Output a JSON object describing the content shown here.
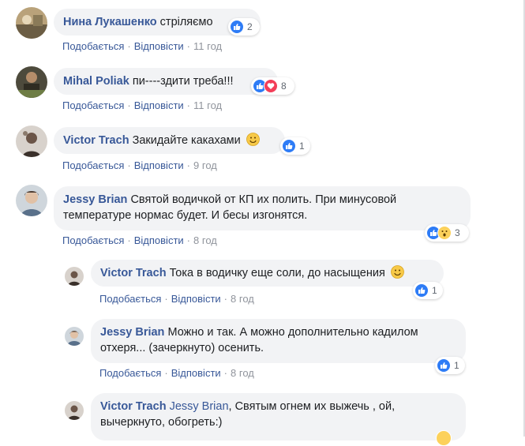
{
  "actions": {
    "like": "Подобається",
    "reply": "Відповісти"
  },
  "comments": [
    {
      "author": "Нина Лукашенко",
      "text": "стріляємо",
      "time": "11 год",
      "reaction_count": "2",
      "reactions": [
        "like"
      ]
    },
    {
      "author": "Mihal Poliak",
      "text": "пи----здити треба!!!",
      "time": "11 год",
      "reaction_count": "8",
      "reactions": [
        "like",
        "love"
      ]
    },
    {
      "author": "Victor Trach",
      "text": "Закидайте какахами",
      "time": "9 год",
      "reaction_count": "1",
      "reactions": [
        "like"
      ],
      "emoji": "smile"
    },
    {
      "author": "Jessy Brian",
      "text": "Святой водичкой от КП их полить. При минусовой температуре нормас будет. И бесы изгонятся.",
      "time": "8 год",
      "reaction_count": "3",
      "reactions": [
        "like",
        "wow"
      ]
    }
  ],
  "replies": [
    {
      "author": "Victor Trach",
      "text": "Тока в водичку еще соли, до насыщения",
      "time": "8 год",
      "reaction_count": "1",
      "reactions": [
        "like"
      ],
      "emoji": "smile"
    },
    {
      "author": "Jessy Brian",
      "text": "Можно и так. А можно дополнительно кадилом отхеря... (зачеркнуто) осенить.",
      "time": "8 год",
      "reaction_count": "1",
      "reactions": [
        "like"
      ]
    },
    {
      "author": "Victor Trach",
      "mention": "Jessy Brian",
      "text": ", Святым огнем их выжечь , ой, вычеркнуто, обогреть:)"
    }
  ],
  "colors": {
    "author": "#385898",
    "bubble": "#f2f3f5",
    "meta": "#90949c",
    "like": "#2e7cf6",
    "love": "#f33e58",
    "wow": "#fcd15b"
  }
}
